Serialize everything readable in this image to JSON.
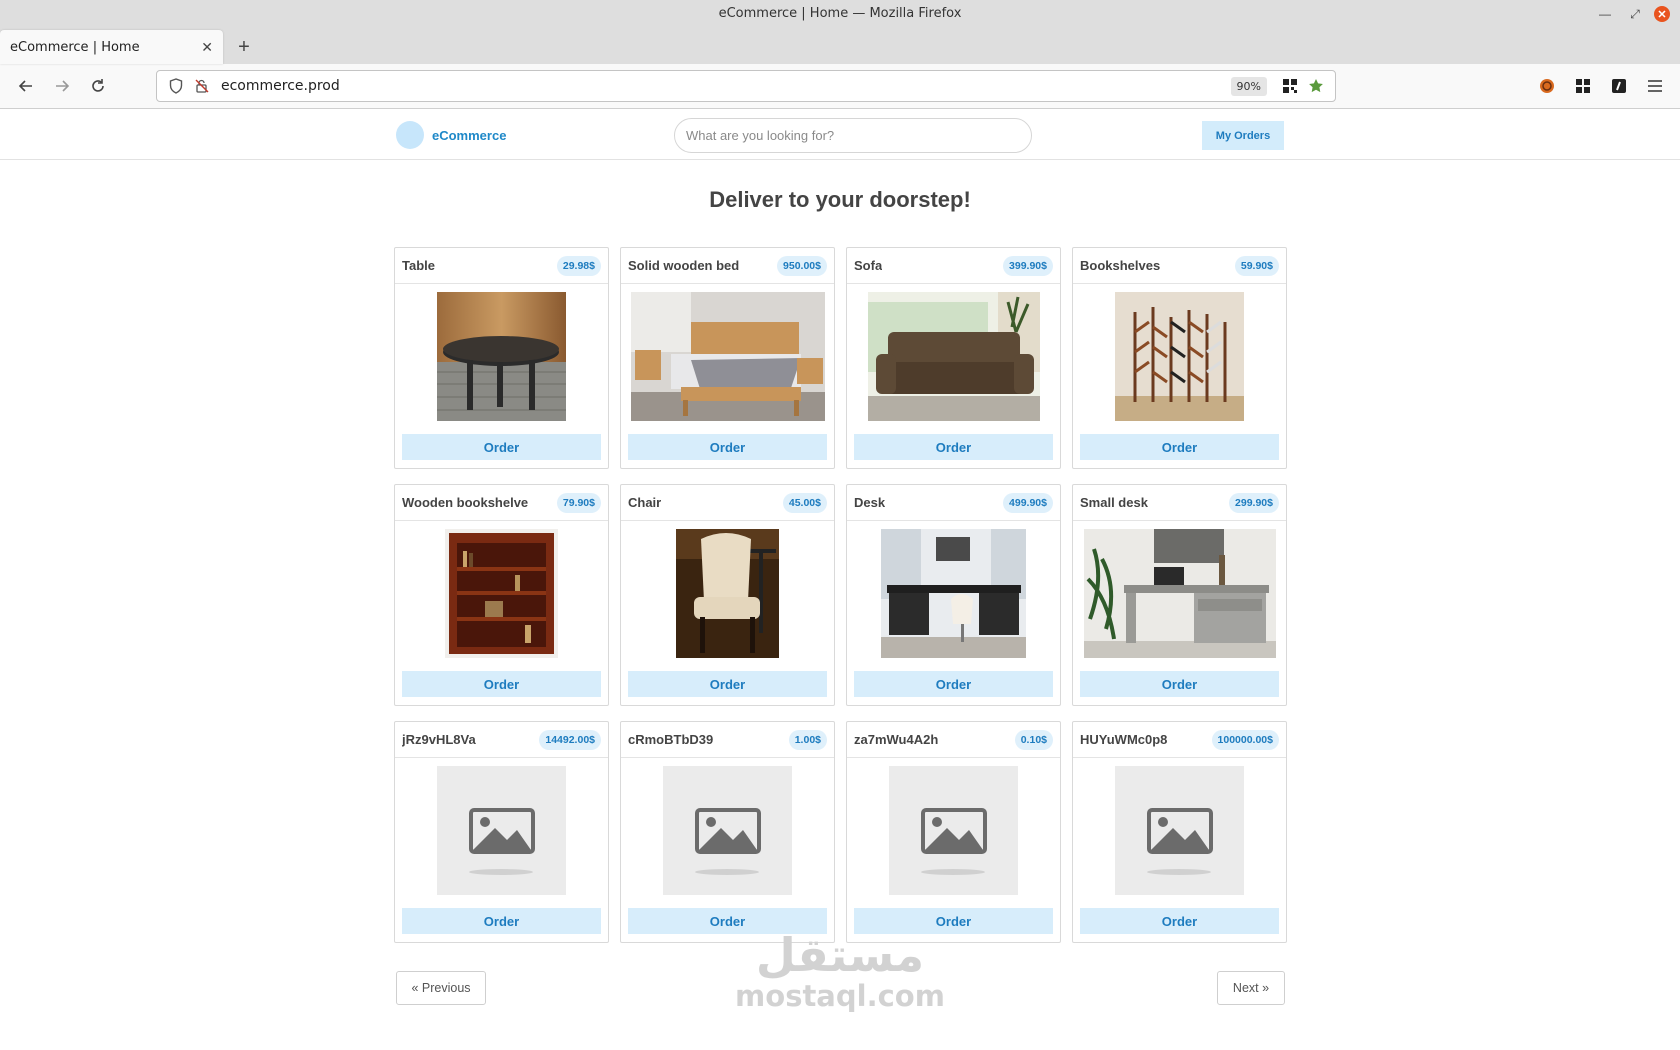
{
  "window": {
    "title": "eCommerce | Home — Mozilla Firefox"
  },
  "browser": {
    "tab_title": "eCommerce | Home",
    "url": "ecommerce.prod",
    "zoom": "90%"
  },
  "site": {
    "brand": "eCommerce",
    "search_placeholder": "What are you looking for?",
    "my_orders": "My Orders",
    "headline": "Deliver to your doorstep!",
    "order_label": "Order",
    "prev_label": "« Previous",
    "next_label": "Next »"
  },
  "products": [
    {
      "name": "Table",
      "price": "29.98$",
      "image": "round-wooden-table"
    },
    {
      "name": "Solid wooden bed",
      "price": "950.00$",
      "image": "wooden-bed"
    },
    {
      "name": "Sofa",
      "price": "399.90$",
      "image": "brown-sofa"
    },
    {
      "name": "Bookshelves",
      "price": "59.90$",
      "image": "tree-bookshelves"
    },
    {
      "name": "Wooden bookshelve",
      "price": "79.90$",
      "image": "wooden-bookcase"
    },
    {
      "name": "Chair",
      "price": "45.00$",
      "image": "cream-chair"
    },
    {
      "name": "Desk",
      "price": "499.90$",
      "image": "black-desk"
    },
    {
      "name": "Small desk",
      "price": "299.90$",
      "image": "grey-desk"
    },
    {
      "name": "jRz9vHL8Va",
      "price": "14492.00$",
      "image": "placeholder"
    },
    {
      "name": "cRmoBTbD39",
      "price": "1.00$",
      "image": "placeholder"
    },
    {
      "name": "za7mWu4A2h",
      "price": "0.10$",
      "image": "placeholder"
    },
    {
      "name": "HUYuWMc0p8",
      "price": "100000.00$",
      "image": "placeholder"
    }
  ],
  "watermark": {
    "arabic": "مستقل",
    "latin": "mostaql.com"
  }
}
